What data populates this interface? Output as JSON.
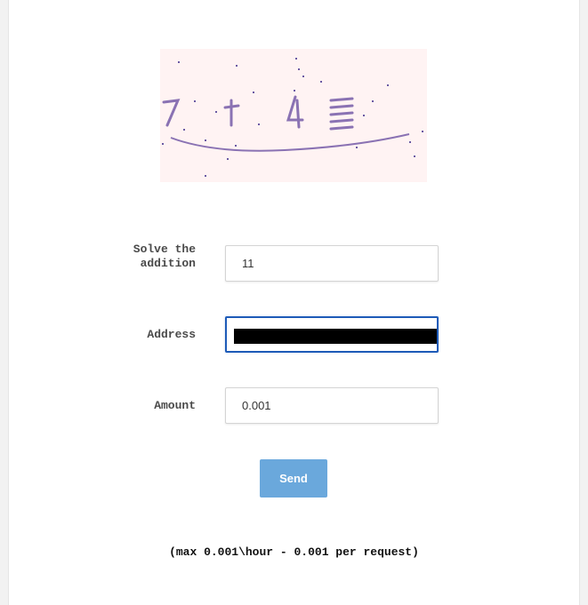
{
  "captcha": {
    "image_text": "7 + 4 =",
    "icon": "captcha-image"
  },
  "form": {
    "solve_label": "Solve the addition",
    "solve_value": "11",
    "address_label": "Address",
    "address_value": "",
    "amount_label": "Amount",
    "amount_value": "0.001",
    "send_label": "Send"
  },
  "limit_note": "(max 0.001\\hour - 0.001 per request)",
  "colors": {
    "button": "#6aa8dc",
    "focus_border": "#1e5bb8",
    "captcha_bg": "#fff3f3",
    "captcha_ink": "#8a72b3"
  }
}
